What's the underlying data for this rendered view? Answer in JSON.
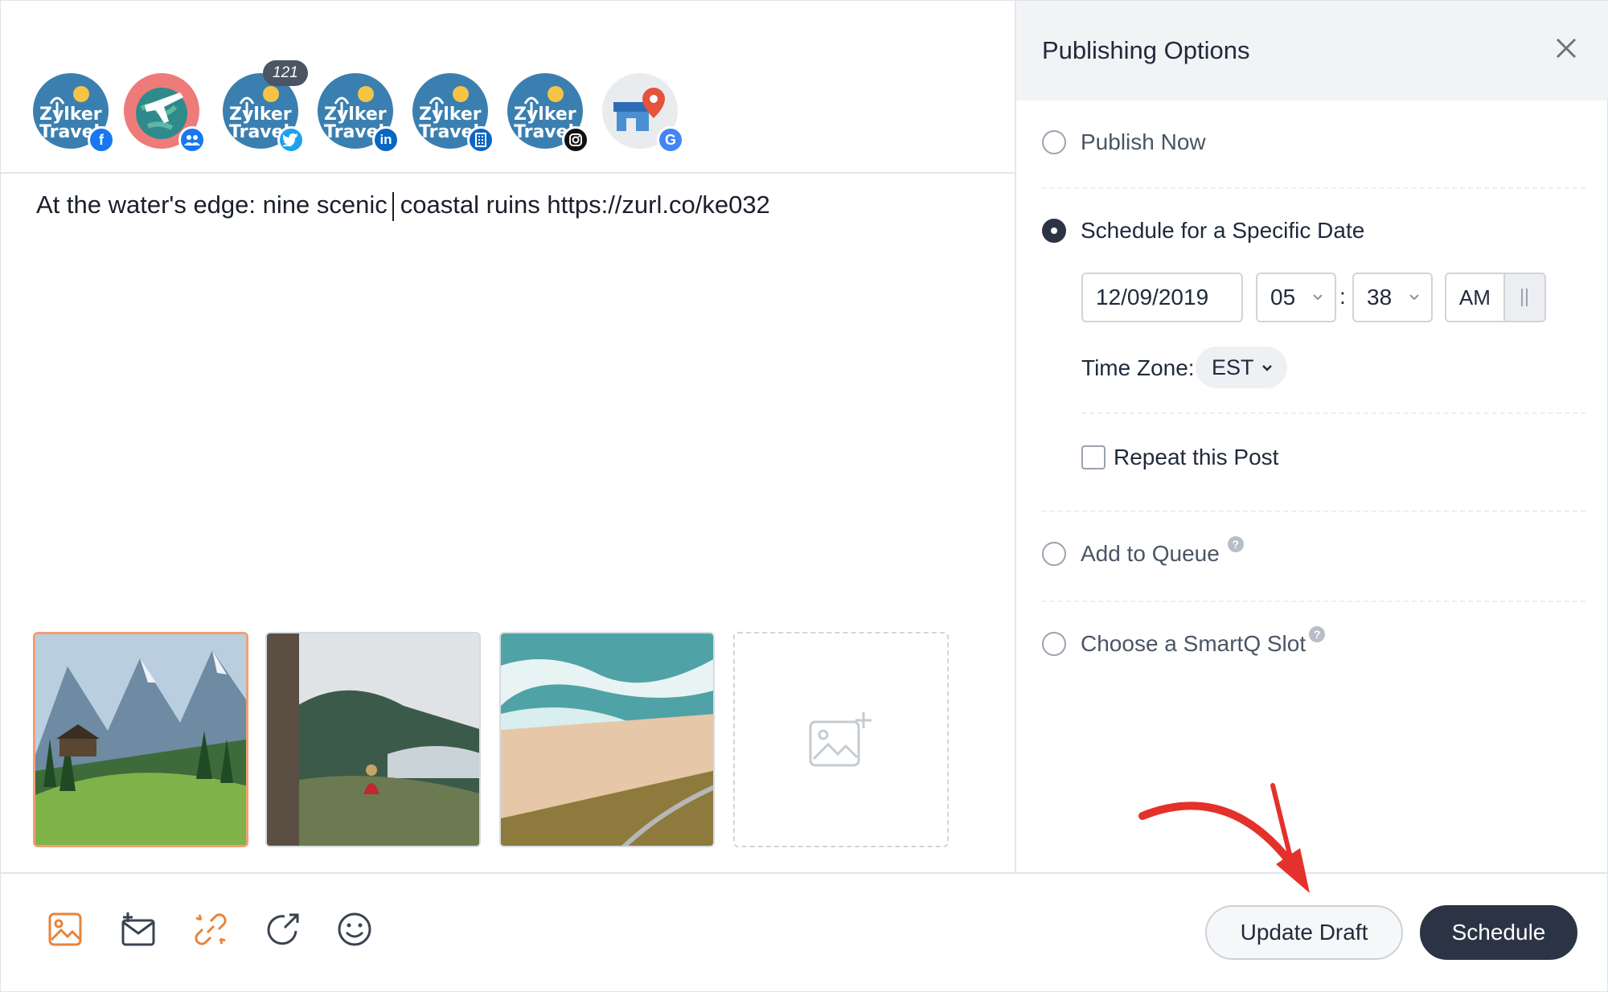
{
  "profiles": {
    "avatar_text": [
      "Zylker",
      "Travel"
    ],
    "count_badge": "121",
    "items": [
      {
        "network": "facebook",
        "badge_icon": "facebook-icon",
        "badge_color": "#1877f2"
      },
      {
        "network": "facebook-group",
        "badge_icon": "group-icon",
        "badge_color": "#1877f2"
      },
      {
        "network": "twitter",
        "badge_icon": "twitter-bird-icon",
        "badge_color": "#1da1f2"
      },
      {
        "network": "linkedin",
        "badge_icon": "linkedin-icon",
        "badge_color": "#0a66c2"
      },
      {
        "network": "linkedin-page",
        "badge_icon": "building-icon",
        "badge_color": "#0a66c2"
      },
      {
        "network": "instagram",
        "badge_icon": "instagram-icon",
        "badge_color": "#111111"
      },
      {
        "network": "google-business",
        "badge_icon": "google-icon",
        "badge_color": "#4285f4"
      }
    ]
  },
  "composer": {
    "text_before_cursor": "At the water's edge: nine scenic",
    "text_after_cursor": "coastal ruins https://zurl.co/ke032",
    "media": [
      {
        "label": "alpine-meadow-cabin",
        "selected": true
      },
      {
        "label": "woman-on-fjord-cliff",
        "selected": false
      },
      {
        "label": "aerial-beach-waves",
        "selected": false
      }
    ]
  },
  "toolbar": {
    "tools": [
      "image-icon",
      "attach-email-icon",
      "link-icon",
      "share-icon",
      "emoji-icon"
    ],
    "accent": "#e8833a"
  },
  "panel": {
    "title": "Publishing Options",
    "options": {
      "publish_now": "Publish Now",
      "schedule": "Schedule for a Specific Date",
      "queue": "Add to Queue",
      "smartq": "Choose a SmartQ Slot"
    },
    "selected_option": "schedule",
    "date": "12/09/2019",
    "hour": "05",
    "minute": "38",
    "ampm": "AM",
    "timezone_label": "Time Zone:",
    "timezone": "EST",
    "repeat_label": "Repeat this Post",
    "repeat_checked": false
  },
  "actions": {
    "update_draft": "Update Draft",
    "schedule": "Schedule"
  },
  "colors": {
    "primary_dark": "#2b3444",
    "annotation_arrow": "#e5312b",
    "selected_thumb_border": "#f0a072"
  }
}
